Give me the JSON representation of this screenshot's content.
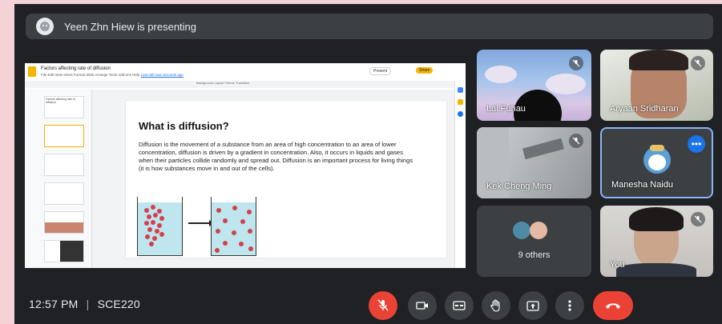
{
  "presenting": {
    "text": "Yeen Zhn Hiew is presenting"
  },
  "slides": {
    "doc_title": "Factors affecting rate of diffusion",
    "menu": "File  Edit  View  Insert  Format  Slide  Arrange  Tools  Add-ons  Help",
    "menu_link": "Last edit was seconds ago",
    "toolbar": "Background  Layout  Theme  Transition",
    "present_label": "Present",
    "share_label": "Share",
    "thumb1": "Factors affecting rate of diffusion",
    "slide_title": "What is diffusion?",
    "slide_body": "Diffusion is the movement of a substance from an area of high concentration to an area of lower concentration, diffusion is driven by a gradient in concentration. Also, it occurs in liquids and gases when their particles collide randomly and spread out. Diffusion is an important process for living things (it is how substances move in and out of the cells)."
  },
  "participants": [
    {
      "name": "Lai Fuhau"
    },
    {
      "name": "Aryaan Sridharan"
    },
    {
      "name": "Kek Cheng Ming"
    },
    {
      "name": "Manesha Naidu"
    },
    {
      "name": "9 others"
    },
    {
      "name": "You"
    }
  ],
  "footer": {
    "time": "12:57 PM",
    "separator": "|",
    "meeting_code": "SCE220"
  },
  "colors": {
    "accent_blue": "#8ab4f8",
    "end_call": "#ea4335",
    "tile_bg": "#3c4043",
    "app_bg": "#202124"
  }
}
